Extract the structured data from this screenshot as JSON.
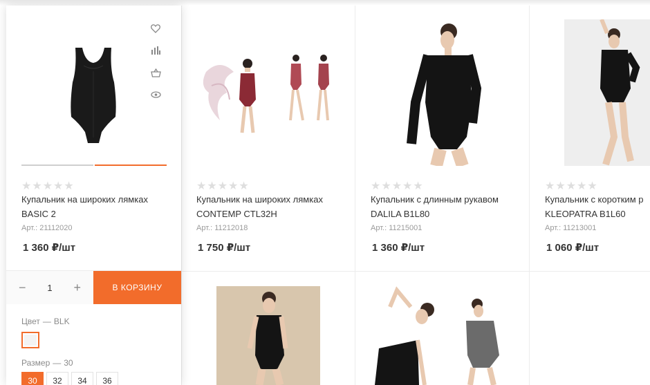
{
  "currency_unit": "₽/шт",
  "products": [
    {
      "title_line1": "Купальник на широких лямках",
      "title_line2": "BASIC 2",
      "art_label": "Арт.:",
      "art": "21112020",
      "price": "1 360 ₽/шт",
      "rating": 0
    },
    {
      "title_line1": "Купальник на широких лямках",
      "title_line2": "CONTEMP CTL32H",
      "art_label": "Арт.:",
      "art": "11212018",
      "price": "1 750 ₽/шт",
      "rating": 0
    },
    {
      "title_line1": "Купальник с длинным рукавом",
      "title_line2": "DALILA B1L80",
      "art_label": "Арт.:",
      "art": "11215001",
      "price": "1 360 ₽/шт",
      "rating": 0
    },
    {
      "title_line1": "Купальник с коротким р",
      "title_line2": "KLEOPATRA B1L60",
      "art_label": "Арт.:",
      "art": "11213001",
      "price": "1 060 ₽/шт",
      "rating": 0
    }
  ],
  "active_card": {
    "tools": [
      "heart-icon",
      "compare-icon",
      "basket-icon",
      "eye-icon"
    ],
    "quantity": "1",
    "minus": "−",
    "plus": "+",
    "cart_button": "В КОРЗИНУ",
    "color_label": "Цвет",
    "color_value": "BLK",
    "size_label": "Размер",
    "size_value": "30",
    "sizes": [
      "30",
      "32",
      "34",
      "36"
    ],
    "selected_size": "30",
    "dash": "—"
  },
  "colors": {
    "accent": "#f26c2b",
    "leotard_black": "#1a1a1a",
    "leotard_burgundy": "#8b2a35",
    "skin": "#e8c9b0"
  }
}
